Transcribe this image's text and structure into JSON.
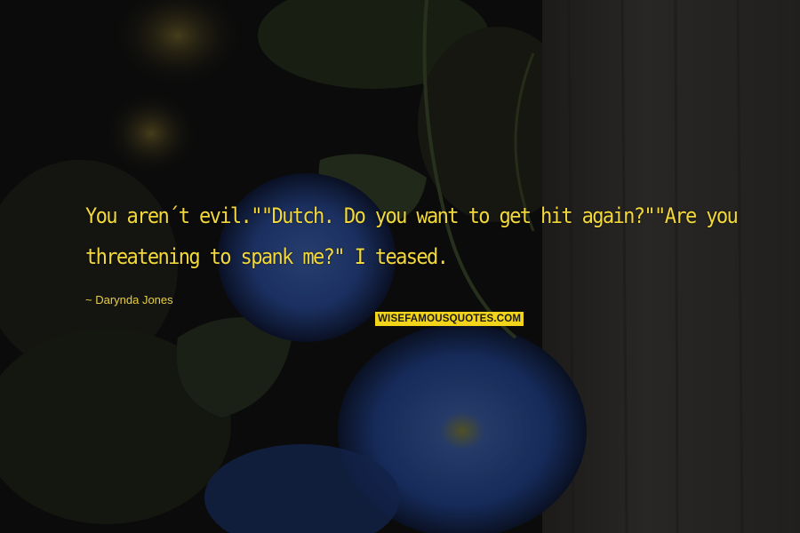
{
  "quote": {
    "line1": "You aren´t evil.\"\"Dutch. Do you want to get hit again?\"\"Are you",
    "line2": "threatening to spank me?\" I teased."
  },
  "author": "~ Darynda Jones",
  "watermark": "WISEFAMOUSQUOTES.COM",
  "colors": {
    "quote_text": "#f2d83a",
    "watermark_bg": "#f2d41a",
    "background": "#141414"
  }
}
